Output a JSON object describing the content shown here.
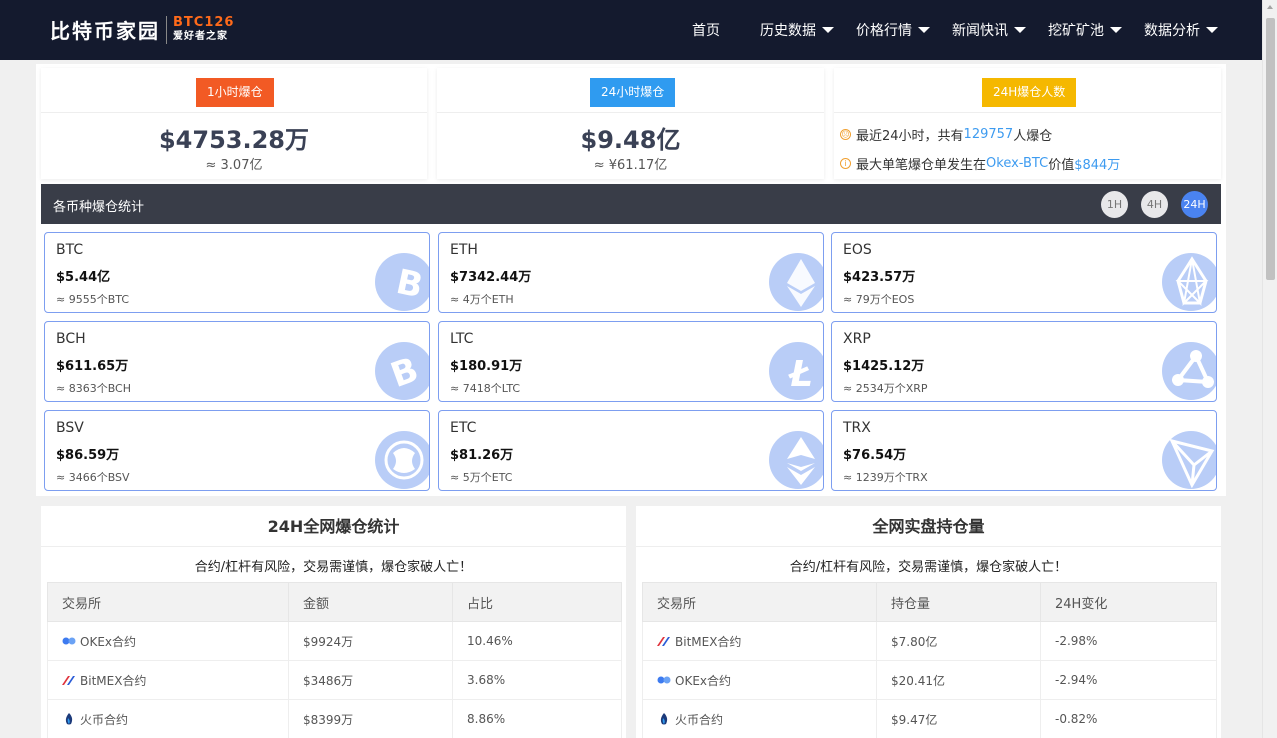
{
  "header": {
    "logo_main": "比特币家园",
    "logo_code": "BTC126",
    "logo_slogan": "爱好者之家",
    "nav": [
      {
        "label": "首页",
        "dropdown": false
      },
      {
        "label": "历史数据",
        "dropdown": true
      },
      {
        "label": "价格行情",
        "dropdown": true
      },
      {
        "label": "新闻快讯",
        "dropdown": true
      },
      {
        "label": "挖矿矿池",
        "dropdown": true
      },
      {
        "label": "数据分析",
        "dropdown": true
      }
    ]
  },
  "stats": {
    "hour1": {
      "badge": "1小时爆仓",
      "value": "$4753.28万",
      "sub": "≈ 3.07亿",
      "color": "#f25a24"
    },
    "hour24": {
      "badge": "24小时爆仓",
      "value": "$9.48亿",
      "sub": "≈ ¥61.17亿",
      "color": "#2f9bf0"
    },
    "people": {
      "badge": "24H爆仓人数",
      "color": "#f5b800",
      "line1_pre": "最近24小时，共有",
      "line1_num": "129757",
      "line1_post": "人爆仓",
      "line2_pre": "最大单笔爆仓单发生在",
      "line2_ex": "Okex-BTC",
      "line2_mid": "价值",
      "line2_val": "$844万"
    }
  },
  "coin_section": {
    "title": "各币种爆仓统计",
    "periods": [
      "1H",
      "4H",
      "24H"
    ],
    "active_period": "24H",
    "coins": [
      {
        "name": "BTC",
        "value": "$5.44亿",
        "sub": "≈ 9555个BTC",
        "icon": "bitcoin-icon"
      },
      {
        "name": "ETH",
        "value": "$7342.44万",
        "sub": "≈ 4万个ETH",
        "icon": "ethereum-icon"
      },
      {
        "name": "EOS",
        "value": "$423.57万",
        "sub": "≈ 79万个EOS",
        "icon": "eos-icon"
      },
      {
        "name": "BCH",
        "value": "$611.65万",
        "sub": "≈ 8363个BCH",
        "icon": "bitcoin-cash-icon"
      },
      {
        "name": "LTC",
        "value": "$180.91万",
        "sub": "≈ 7418个LTC",
        "icon": "litecoin-icon"
      },
      {
        "name": "XRP",
        "value": "$1425.12万",
        "sub": "≈ 2534万个XRP",
        "icon": "ripple-icon"
      },
      {
        "name": "BSV",
        "value": "$86.59万",
        "sub": "≈ 3466个BSV",
        "icon": "bsv-dragon-icon"
      },
      {
        "name": "ETC",
        "value": "$81.26万",
        "sub": "≈ 5万个ETC",
        "icon": "ethereum-classic-icon"
      },
      {
        "name": "TRX",
        "value": "$76.54万",
        "sub": "≈ 1239万个TRX",
        "icon": "tron-icon"
      }
    ]
  },
  "liquidation_panel": {
    "title": "24H全网爆仓统计",
    "note": "合约/杠杆有风险，交易需谨慎，爆仓家破人亡！",
    "columns": [
      "交易所",
      "金额",
      "占比"
    ],
    "rows": [
      {
        "exchange": "OKEx合约",
        "icon": "okex-icon",
        "c1": "$9924万",
        "c2": "10.46%"
      },
      {
        "exchange": "BitMEX合约",
        "icon": "bitmex-icon",
        "c1": "$3486万",
        "c2": "3.68%"
      },
      {
        "exchange": "火币合约",
        "icon": "huobi-icon",
        "c1": "$8399万",
        "c2": "8.86%"
      }
    ]
  },
  "position_panel": {
    "title": "全网实盘持仓量",
    "note": "合约/杠杆有风险，交易需谨慎，爆仓家破人亡！",
    "columns": [
      "交易所",
      "持仓量",
      "24H变化"
    ],
    "rows": [
      {
        "exchange": "BitMEX合约",
        "icon": "bitmex-icon",
        "c1": "$7.80亿",
        "c2": "-2.98%"
      },
      {
        "exchange": "OKEx合约",
        "icon": "okex-icon",
        "c1": "$20.41亿",
        "c2": "-2.94%"
      },
      {
        "exchange": "火币合约",
        "icon": "huobi-icon",
        "c1": "$9.47亿",
        "c2": "-0.82%"
      }
    ]
  }
}
